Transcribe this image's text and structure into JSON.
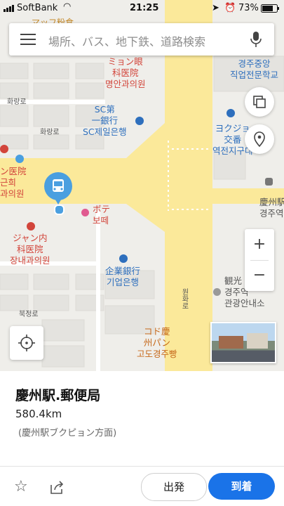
{
  "status": {
    "carrier": "SoftBank",
    "time": "21:25",
    "battery": "73%"
  },
  "search": {
    "placeholder": "場所、バス、地下鉄、道路検索"
  },
  "map": {
    "labels": [
      {
        "id": "label-top-left",
        "text": "マッフ粉食"
      },
      {
        "id": "label-myon",
        "text": "ミョン眼\n科医院\n명안과의원"
      },
      {
        "id": "label-gyeongju",
        "text": "경주중앙\n직업전문학교"
      },
      {
        "id": "label-hwarang-1",
        "text": "화랑로"
      },
      {
        "id": "label-sc",
        "text": "SC第\n一銀行\nSC제일은행"
      },
      {
        "id": "label-yokujon",
        "text": "ヨクジョ\n交番\n역전지구대"
      },
      {
        "id": "label-hwarang-2",
        "text": "화랑로"
      },
      {
        "id": "label-left-clinic",
        "text": "ン医院\n근희\n과의원"
      },
      {
        "id": "label-bote",
        "text": "ボテ\n보떼"
      },
      {
        "id": "label-gyeongju-station",
        "text": "慶州駅\n경주역"
      },
      {
        "id": "label-jang",
        "text": "ジャン内\n科医院\n장내과의원"
      },
      {
        "id": "label-ibk",
        "text": "企業銀行\n기업은행"
      },
      {
        "id": "label-bukjeong",
        "text": "북정로"
      },
      {
        "id": "label-wonhwa",
        "text": "원화로"
      },
      {
        "id": "label-tourism",
        "text": "観光\n경주역\n관광안내소"
      },
      {
        "id": "label-kodo",
        "text": "コド慶\n州パン\n고도경주빵"
      }
    ]
  },
  "card": {
    "title": "慶州駅.郵便局",
    "distance": "580.4km",
    "direction": "(慶州駅ブクピョン方面)"
  },
  "actions": {
    "depart_label": "出発",
    "arrive_label": "到着"
  },
  "colors": {
    "accent": "#1a73e8",
    "road_yellow": "#fbe99a",
    "marker": "#4a9fe0"
  }
}
